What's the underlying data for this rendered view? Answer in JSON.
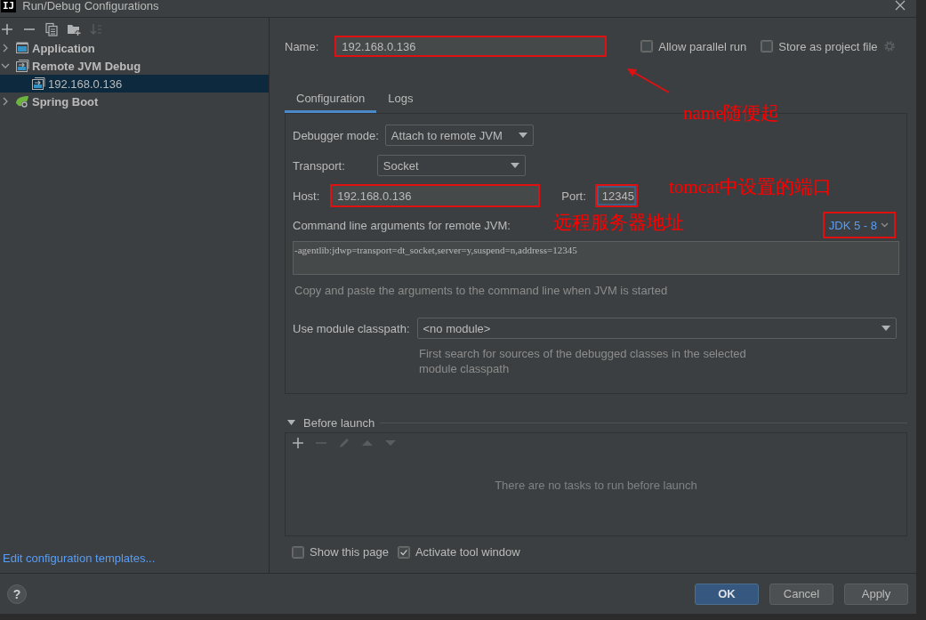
{
  "window": {
    "logo": "IJ",
    "title": "Run/Debug Configurations"
  },
  "sidebar": {
    "toolbar": [
      {
        "kind": "add",
        "disabled": false
      },
      {
        "kind": "remove",
        "disabled": false
      },
      {
        "kind": "copy",
        "disabled": false
      },
      {
        "kind": "folder",
        "disabled": false
      },
      {
        "kind": "sort",
        "disabled": true
      }
    ],
    "items": [
      {
        "label": "Application",
        "kind": "application",
        "expanded": false,
        "selected": false
      },
      {
        "label": "Remote JVM Debug",
        "kind": "remote",
        "expanded": true,
        "selected": false,
        "children": [
          {
            "label": "192.168.0.136",
            "kind": "remote",
            "selected": true
          }
        ]
      },
      {
        "label": "Spring Boot",
        "kind": "spring",
        "expanded": false,
        "selected": false
      }
    ],
    "link": "Edit configuration templates..."
  },
  "name_row": {
    "label": "Name:",
    "value": "192.168.0.136",
    "highlighted": true,
    "options": [
      {
        "label": "Allow parallel run",
        "checked": false
      },
      {
        "label": "Store as project file",
        "checked": false
      }
    ]
  },
  "tabs": [
    {
      "label": "Configuration",
      "selected": true
    },
    {
      "label": "Logs",
      "selected": false
    }
  ],
  "configuration": {
    "debugger_mode": {
      "label": "Debugger mode:",
      "value": "Attach to remote JVM"
    },
    "transport": {
      "label": "Transport:",
      "value": "Socket"
    },
    "host": {
      "label": "Host:",
      "value": "192.168.0.136",
      "highlighted": true
    },
    "port": {
      "label": "Port:",
      "value": "12345",
      "highlighted": true,
      "focused": true
    },
    "command_line": {
      "label": "Command line arguments for remote JVM:",
      "jdk": "JDK 5 - 8",
      "jdk_highlighted": true,
      "value": "-agentlib:jdwp=transport=dt_socket,server=y,suspend=n,address=12345",
      "hint": "Copy and paste the arguments to the command line when JVM is started"
    },
    "module": {
      "label": "Use module classpath:",
      "value": "<no module>",
      "hint": "First search for sources of the debugged classes in the selected module classpath"
    }
  },
  "before_launch": {
    "label": "Before launch",
    "expanded": true,
    "toolbar": [
      {
        "kind": "add",
        "disabled": false
      },
      {
        "kind": "remove",
        "disabled": true
      },
      {
        "kind": "edit",
        "disabled": true
      },
      {
        "kind": "up",
        "disabled": true
      },
      {
        "kind": "down",
        "disabled": true
      }
    ],
    "empty": "There are no tasks to run before launch"
  },
  "footer_options": [
    {
      "label": "Show this page",
      "checked": false
    },
    {
      "label": "Activate tool window",
      "checked": true
    }
  ],
  "help_button": "?",
  "buttons": [
    {
      "label": "OK",
      "default": true
    },
    {
      "label": "Cancel",
      "default": false
    },
    {
      "label": "Apply",
      "default": false
    }
  ],
  "annotations": [
    {
      "text": "name随便起",
      "arrow": true
    },
    {
      "text": "tomcat中设置的端口",
      "arrow": false
    },
    {
      "text": "远程服务器地址",
      "arrow": false
    }
  ]
}
